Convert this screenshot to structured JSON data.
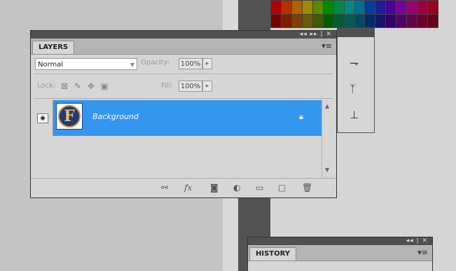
{
  "swatch_colors": [
    "#b30000",
    "#b33000",
    "#b36000",
    "#a08a00",
    "#5a8a00",
    "#008a00",
    "#008a4a",
    "#008a80",
    "#006f9a",
    "#003f9a",
    "#1d1d9a",
    "#4a009a",
    "#7a009a",
    "#9a006f",
    "#9a003f",
    "#9a0020",
    "#7a0000",
    "#7a2000",
    "#7a4200",
    "#6a5c00",
    "#3e5c00",
    "#005c00",
    "#005c32",
    "#005c56",
    "#004a68",
    "#002a68",
    "#141468",
    "#320068",
    "#520068",
    "#68004a",
    "#68002a",
    "#680016"
  ],
  "titlebar": {
    "collapse_icon": "double-chevron-left-icon",
    "controls_text": "◂◂   ▸▸ | ✕"
  },
  "layers_panel": {
    "tab_label": "LAYERS",
    "menu_icon": "panel-menu-icon",
    "blend_mode": "Normal",
    "opacity_label": "Opacity:",
    "opacity_value": "100%",
    "lock_label": "Lock:",
    "fill_label": "Fill:",
    "fill_value": "100%",
    "layers": [
      {
        "name": "Background",
        "thumb_letter": "F",
        "visible": true,
        "locked": true,
        "selected": true
      }
    ],
    "bottom_icons": [
      "link-layers-icon",
      "fx-icon",
      "mask-icon",
      "adjustment-icon",
      "group-folder-icon",
      "new-layer-icon",
      "trash-icon"
    ]
  },
  "tool_strip": {
    "icons": [
      "adjustments-icon",
      "brush-tool-icon",
      "clone-source-icon"
    ]
  },
  "history_panel": {
    "tab_label": "HISTORY",
    "controls_text": "◂◂ | ✕"
  }
}
